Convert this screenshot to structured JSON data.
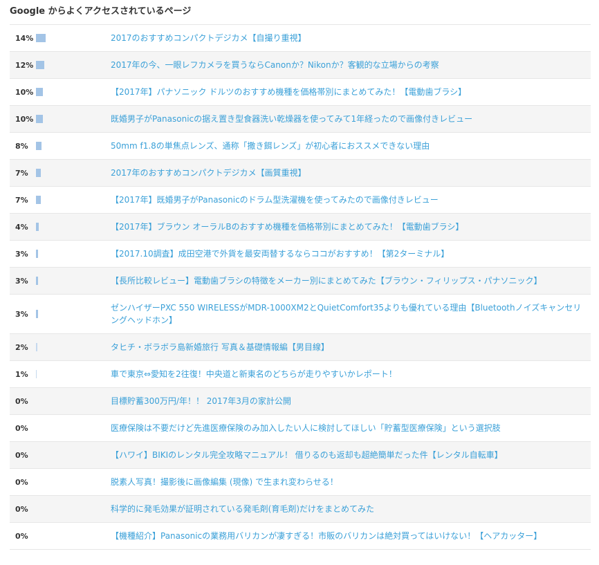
{
  "title": "Google からよくアクセスされているページ",
  "rows": [
    {
      "percent": "14%",
      "share": 14,
      "label": "2017のおすすめコンパクトデジカメ【自撮り重視】"
    },
    {
      "percent": "12%",
      "share": 12,
      "label": "2017年の今、一眼レフカメラを買うならCanonか？Nikonか？客観的な立場からの考察"
    },
    {
      "percent": "10%",
      "share": 10,
      "label": "【2017年】パナソニック ドルツのおすすめ機種を価格帯別にまとめてみた！【電動歯ブラシ】"
    },
    {
      "percent": "10%",
      "share": 10,
      "label": "既婚男子がPanasonicの据え置き型食器洗い乾燥器を使ってみて1年経ったので画像付きレビュー"
    },
    {
      "percent": "8%",
      "share": 8,
      "label": "50mm f1.8の単焦点レンズ、通称「撒き餌レンズ」が初心者におススメできない理由"
    },
    {
      "percent": "7%",
      "share": 7,
      "label": "2017年のおすすめコンパクトデジカメ【画質重視】"
    },
    {
      "percent": "7%",
      "share": 7,
      "label": "【2017年】既婚男子がPanasonicのドラム型洗濯機を使ってみたので画像付きレビュー"
    },
    {
      "percent": "4%",
      "share": 4,
      "label": "【2017年】ブラウン オーラルBのおすすめ機種を価格帯別にまとめてみた！【電動歯ブラシ】"
    },
    {
      "percent": "3%",
      "share": 3,
      "label": "【2017.10調査】成田空港で外貨を最安両替するならココがおすすめ！【第2ターミナル】"
    },
    {
      "percent": "3%",
      "share": 3,
      "label": "【長所比較レビュー】電動歯ブラシの特徴をメーカー別にまとめてみた【ブラウン・フィリップス・パナソニック】"
    },
    {
      "percent": "3%",
      "share": 3,
      "label": "ゼンハイザーPXC 550 WIRELESSがMDR-1000XM2とQuietComfort35よりも優れている理由【Bluetoothノイズキャンセリングヘッドホン】"
    },
    {
      "percent": "2%",
      "share": 2,
      "label": "タヒチ・ボラボラ島新婚旅行 写真＆基礎情報編【男目線】"
    },
    {
      "percent": "1%",
      "share": 1,
      "label": "車で東京⇔愛知を2往復！中央道と新東名のどちらが走りやすいかレポート！"
    },
    {
      "percent": "0%",
      "share": 0,
      "label": "目標貯蓄300万円/年！！ 2017年3月の家計公開"
    },
    {
      "percent": "0%",
      "share": 0,
      "label": "医療保険は不要だけど先進医療保険のみ加入したい人に検討してほしい「貯蓄型医療保険」という選択肢"
    },
    {
      "percent": "0%",
      "share": 0,
      "label": "【ハワイ】BIKIのレンタル完全攻略マニュアル！ 借りるのも返却も超絶簡単だった件【レンタル自転車】"
    },
    {
      "percent": "0%",
      "share": 0,
      "label": "脱素人写真！撮影後に画像編集 (現像) で生まれ変わらせる！"
    },
    {
      "percent": "0%",
      "share": 0,
      "label": "科学的に発毛効果が証明されている発毛剤(育毛剤)だけをまとめてみた"
    },
    {
      "percent": "0%",
      "share": 0,
      "label": "【機種紹介】Panasonicの業務用バリカンが凄すぎる！市販のバリカンは絶対買ってはいけない！【ヘアカッター】"
    }
  ],
  "colors": {
    "bar": "#a3c4e6",
    "link": "#3aa0d8",
    "alt_row": "#f5f5f5"
  }
}
